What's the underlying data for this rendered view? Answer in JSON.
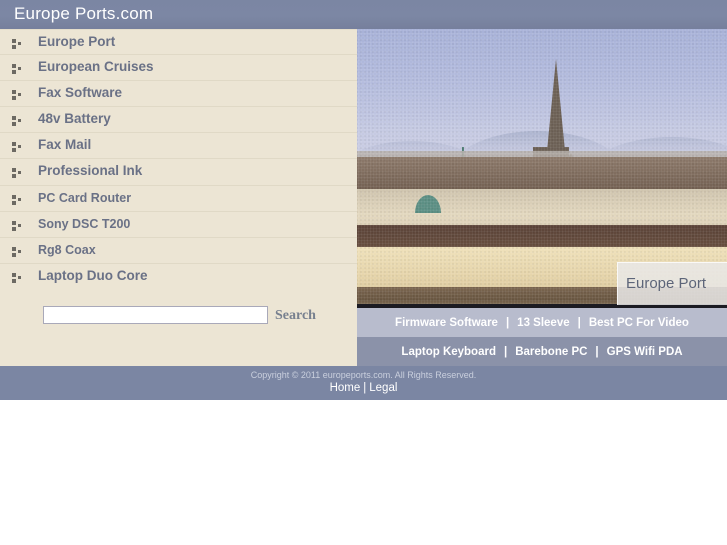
{
  "header": {
    "title": "Europe Ports.com",
    "bg_color": "#7b86a3"
  },
  "menu": {
    "items": [
      {
        "label": "Europe Port",
        "icon": "bullet-icon"
      },
      {
        "label": "European Cruises",
        "icon": "bullet-icon"
      },
      {
        "label": "Fax Software",
        "icon": "bullet-icon"
      },
      {
        "label": "48v Battery",
        "icon": "bullet-icon"
      },
      {
        "label": "Fax Mail",
        "icon": "bullet-icon"
      },
      {
        "label": "Professional Ink",
        "icon": "bullet-icon"
      },
      {
        "label": "PC Card Router",
        "icon": "bullet-icon"
      },
      {
        "label": "Sony DSC T200",
        "icon": "bullet-icon"
      },
      {
        "label": "Rg8 Coax",
        "icon": "bullet-icon"
      },
      {
        "label": "Laptop Duo Core",
        "icon": "bullet-icon"
      }
    ],
    "bg_color": "#ece5d4",
    "link_color": "#6a7186"
  },
  "search": {
    "value": "",
    "placeholder": "",
    "button_label": "Search"
  },
  "photo": {
    "badge_label": "Europe Port",
    "alt": "Vienna skyline with Belvedere Palace and St. Stephen's Cathedral spire"
  },
  "link_bars": {
    "row1": {
      "bg_color": "#b8bccd",
      "links": [
        "Firmware Software",
        "13 Sleeve",
        "Best PC For Video"
      ],
      "separator": "|"
    },
    "row2": {
      "bg_color": "#8b92a9",
      "links": [
        "Laptop Keyboard",
        "Barebone PC",
        "GPS Wifi PDA"
      ],
      "separator": "|"
    }
  },
  "footer": {
    "copyright": "Copyright © 2011 europeports.com. All Rights Reserved.",
    "links": [
      "Home",
      "Legal"
    ],
    "separator": "|",
    "bg_color": "#7b86a3"
  }
}
